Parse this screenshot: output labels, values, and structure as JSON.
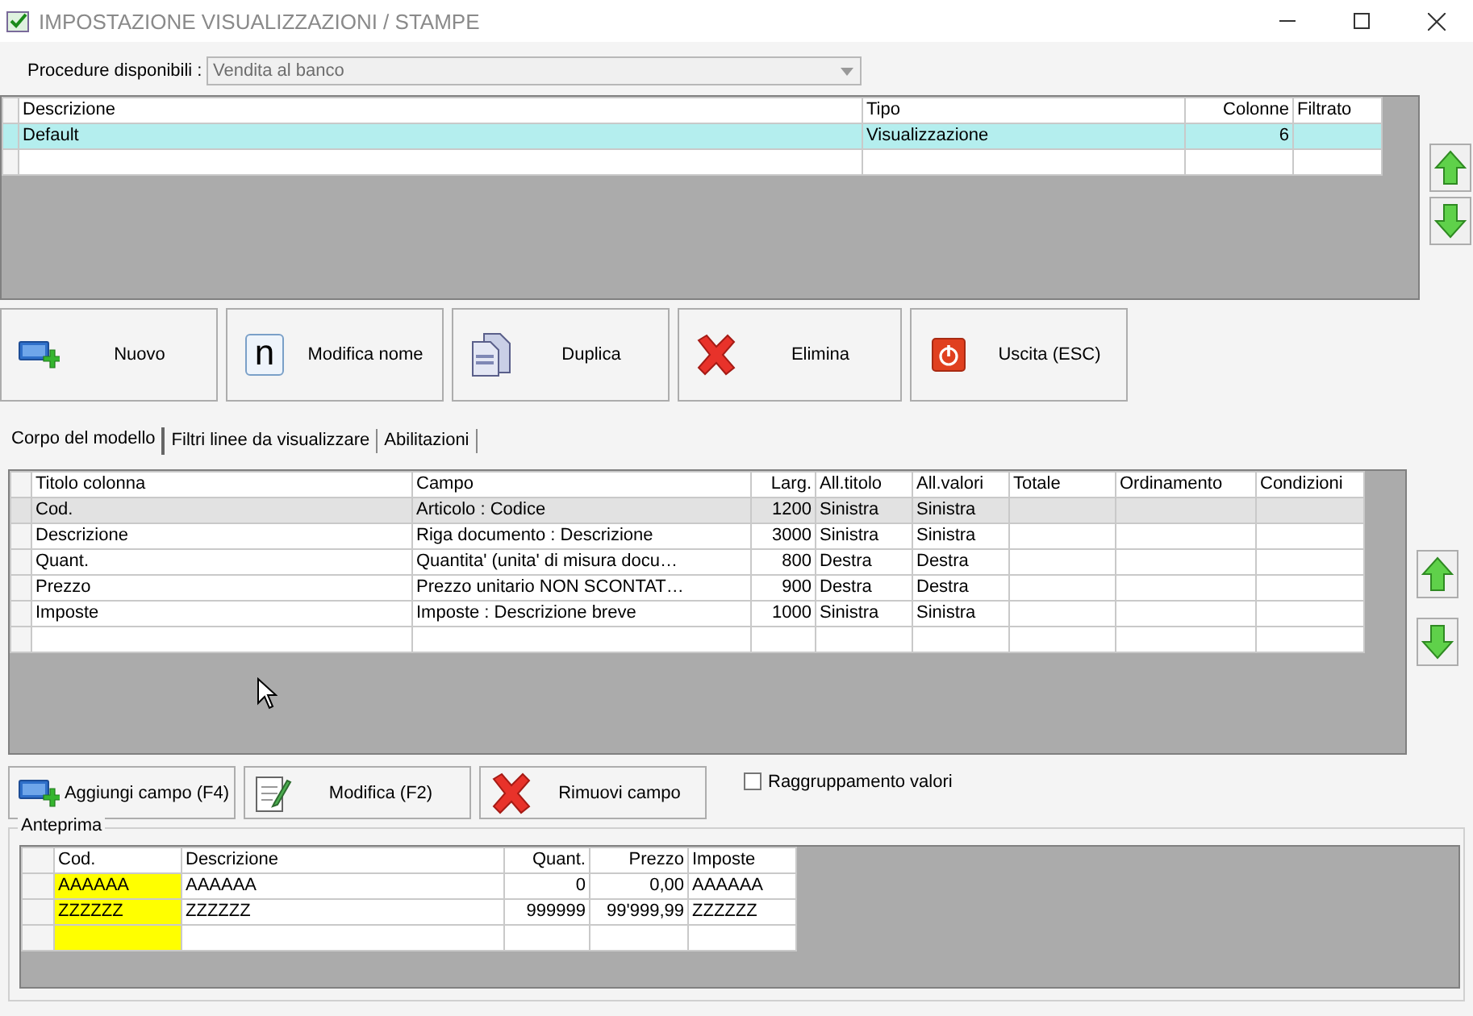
{
  "window": {
    "title": "IMPOSTAZIONE VISUALIZZAZIONI / STAMPE"
  },
  "procedure": {
    "label": "Procedure disponibili :",
    "value": "Vendita al banco",
    "disabled": true
  },
  "models": {
    "columns": [
      {
        "label": "Descrizione"
      },
      {
        "label": "Tipo"
      },
      {
        "label": "Colonne"
      },
      {
        "label": "Filtrato"
      }
    ],
    "rows": [
      {
        "cells": [
          "Default",
          "Visualizzazione",
          "6",
          ""
        ],
        "selected": true
      }
    ]
  },
  "model_buttons": [
    {
      "label": "Nuovo",
      "kind": "new"
    },
    {
      "label": "Modifica nome",
      "kind": "rename",
      "glyph": "n"
    },
    {
      "label": "Duplica",
      "kind": "copy"
    },
    {
      "label": "Elimina",
      "kind": "delete"
    },
    {
      "label": "Uscita (ESC)",
      "kind": "exit"
    }
  ],
  "tabs": [
    {
      "label": "Corpo del modello",
      "selected": true
    },
    {
      "label": "Filtri linee da visualizzare",
      "selected": false
    },
    {
      "label": "Abilitazioni",
      "selected": false
    }
  ],
  "fields": {
    "columns": [
      {
        "label": "Titolo colonna"
      },
      {
        "label": "Campo"
      },
      {
        "label": "Larg."
      },
      {
        "label": "All.titolo"
      },
      {
        "label": "All.valori"
      },
      {
        "label": "Totale"
      },
      {
        "label": "Ordinamento"
      },
      {
        "label": "Condizioni"
      }
    ],
    "rows": [
      {
        "cells": [
          "Cod.",
          "Articolo : Codice",
          "1200",
          "Sinistra",
          "Sinistra",
          "",
          "",
          ""
        ],
        "selected": true
      },
      {
        "cells": [
          "Descrizione",
          "Riga documento : Descrizione",
          "3000",
          "Sinistra",
          "Sinistra",
          "",
          "",
          ""
        ],
        "selected": false
      },
      {
        "cells": [
          "Quant.",
          "Quantita' (unita' di misura docu…",
          "800",
          "Destra",
          "Destra",
          "",
          "",
          ""
        ],
        "selected": false
      },
      {
        "cells": [
          "Prezzo",
          "Prezzo unitario NON SCONTAT…",
          "900",
          "Destra",
          "Destra",
          "",
          "",
          ""
        ],
        "selected": false
      },
      {
        "cells": [
          "Imposte",
          "Imposte : Descrizione breve",
          "1000",
          "Sinistra",
          "Sinistra",
          "",
          "",
          ""
        ],
        "selected": false
      }
    ]
  },
  "field_buttons": [
    {
      "label": "Aggiungi campo (F4)",
      "kind": "new"
    },
    {
      "label": "Modifica (F2)",
      "kind": "edit"
    },
    {
      "label": "Rimuovi campo",
      "kind": "delete"
    }
  ],
  "grouping": {
    "label": "Raggruppamento valori",
    "checked": false
  },
  "preview": {
    "title": "Anteprima",
    "columns": [
      {
        "label": "Cod.",
        "highlighted": true
      },
      {
        "label": "Descrizione",
        "highlighted": false
      },
      {
        "label": "Quant.",
        "highlighted": false
      },
      {
        "label": "Prezzo",
        "highlighted": false
      },
      {
        "label": "Imposte",
        "highlighted": false
      }
    ],
    "rows": [
      {
        "cells": [
          "AAAAAA",
          "AAAAAA",
          "0",
          "0,00",
          "AAAAAA"
        ]
      },
      {
        "cells": [
          "ZZZZZZ",
          "ZZZZZZ",
          "999999",
          "99'999,99",
          "ZZZZZZ"
        ]
      }
    ]
  }
}
